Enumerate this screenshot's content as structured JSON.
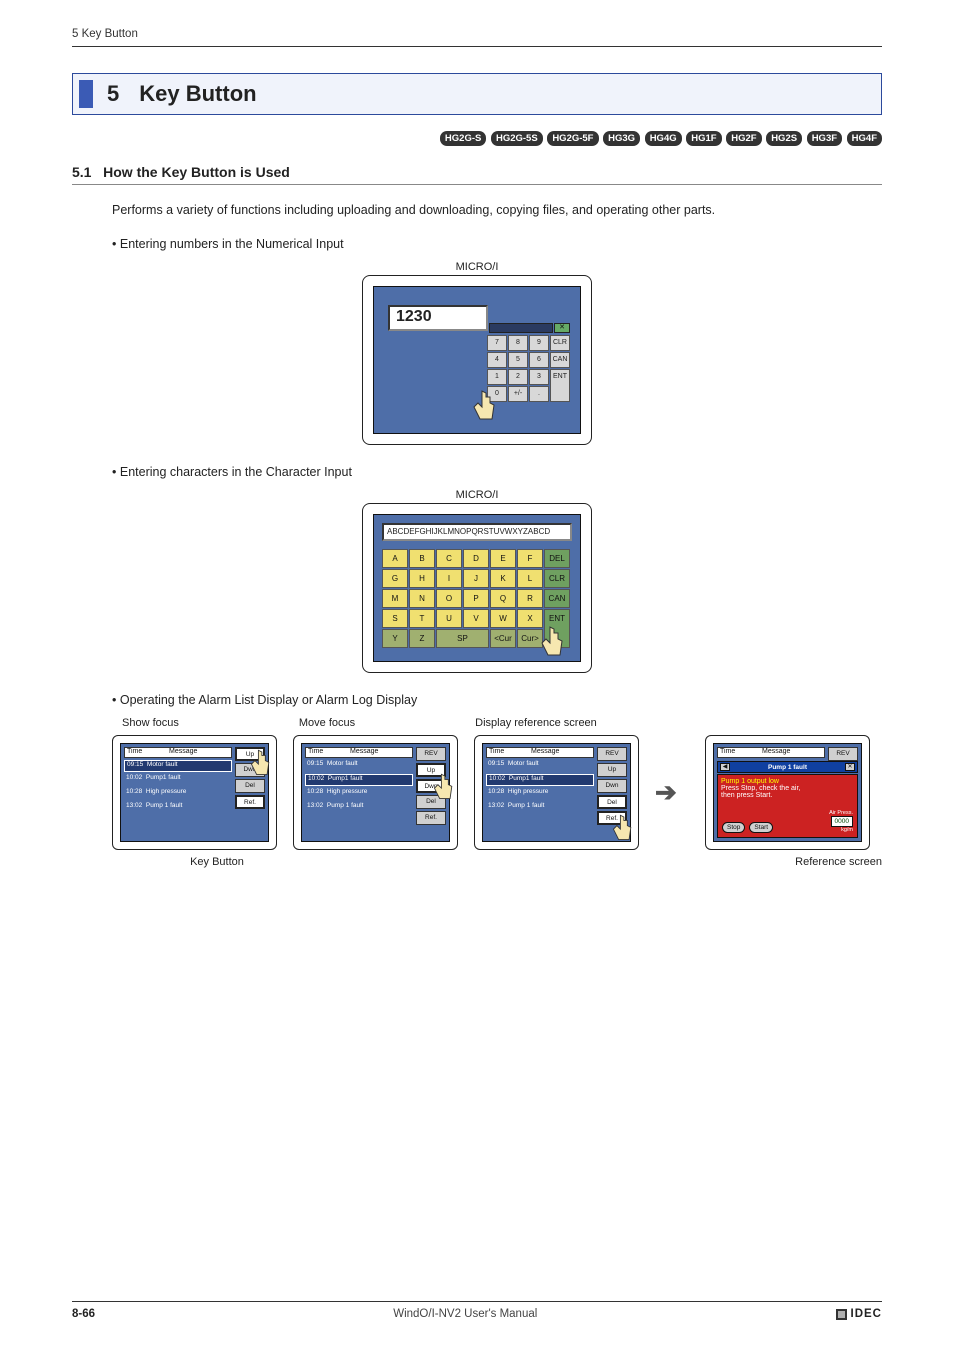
{
  "running_head": "5 Key Button",
  "chapter": {
    "num": "5",
    "title": "Key Button"
  },
  "badges": [
    "HG2G-S",
    "HG2G-5S",
    "HG2G-5F",
    "HG3G",
    "HG4G",
    "HG1F",
    "HG2F",
    "HG2S",
    "HG3F",
    "HG4F"
  ],
  "section": {
    "num": "5.1",
    "title": "How the Key Button is Used"
  },
  "intro": "Performs a variety of functions including uploading and downloading, copying files, and operating other parts.",
  "bullets": {
    "num_input": "Entering numbers in the Numerical Input",
    "char_input": "Entering characters in the Character Input",
    "alarm": "Operating the Alarm List Display or Alarm Log Display"
  },
  "micro_label": "MICRO/I",
  "num_keypad": {
    "display": "1230",
    "title_close": "✕",
    "keys": [
      "7",
      "8",
      "9",
      "CLR",
      "4",
      "5",
      "6",
      "CAN",
      "1",
      "2",
      "3",
      "ENT",
      "0",
      "+/-",
      ".",
      ""
    ]
  },
  "char_keypad": {
    "display": "ABCDEFGHIJKLMNOPQRSTUVWXYZABCD",
    "rows": [
      [
        "A",
        "B",
        "C",
        "D",
        "E",
        "F",
        "DEL"
      ],
      [
        "G",
        "H",
        "I",
        "J",
        "K",
        "L",
        "CLR"
      ],
      [
        "M",
        "N",
        "O",
        "P",
        "Q",
        "R",
        "CAN"
      ],
      [
        "S",
        "T",
        "U",
        "V",
        "W",
        "X",
        "ENT"
      ],
      [
        "Y",
        "Z",
        "SP",
        "",
        "<Cur",
        "Cur>",
        ""
      ]
    ]
  },
  "alarm_section": {
    "labels": [
      "Show focus",
      "Move focus",
      "Display reference screen"
    ],
    "header": {
      "time": "Time",
      "message": "Message"
    },
    "side_buttons": {
      "rev": "REV",
      "up": "Up",
      "dwn": "Dwn",
      "del": "Del",
      "ref": "Ref."
    },
    "rows": [
      {
        "time": "09:15",
        "msg": "Motor fault"
      },
      {
        "time": "10:02",
        "msg": "Pump1 fault"
      },
      {
        "time": "10:28",
        "msg": "High pressure"
      },
      {
        "time": "13:02",
        "msg": "Pump 1 fault"
      }
    ],
    "ref_screen": {
      "title": "Pump 1 fault",
      "line1": "Pump 1 output low",
      "line2": "Press Stop, check the air,",
      "line3": "then press Start.",
      "air_label": "Air Press.",
      "air_value": "0000",
      "air_unit": "kg/m",
      "btn_stop": "Stop",
      "btn_start": "Start"
    },
    "captions": {
      "key_button": "Key Button",
      "ref_screen": "Reference screen"
    }
  },
  "footer": {
    "page": "8-66",
    "manual": "WindO/I-NV2 User's Manual",
    "logo": "IDEC"
  }
}
